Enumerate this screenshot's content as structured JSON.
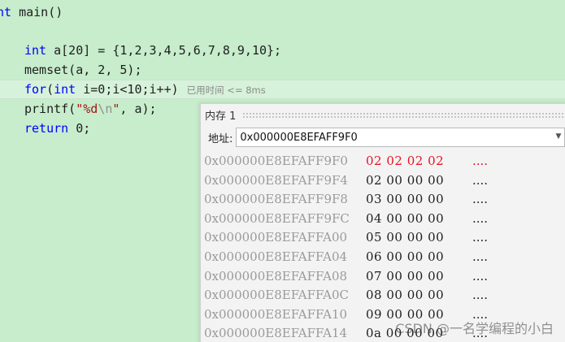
{
  "editor": {
    "line1": {
      "kw": "nt",
      "rest": " main()"
    },
    "line2": {
      "kw": "int",
      "rest": " a[20] = {1,2,3,4,5,6,7,8,9,10};"
    },
    "line3": {
      "rest": "memset(a, 2, 5);"
    },
    "line4": {
      "kw1": "for",
      "p1": "(",
      "kw2": "int",
      "rest": " i=0;i<10;i++)",
      "elapsed": "已用时间 <= 8ms"
    },
    "line5": {
      "fn": "printf(",
      "str1": "\"%d",
      "esc": "\\n",
      "str2": "\"",
      "rest": ", a);"
    },
    "line6": {
      "kw": "return",
      "rest": " 0;"
    }
  },
  "memory": {
    "title": "内存 1",
    "address_label": "地址:",
    "address_value": "0x000000E8EFAFF9F0",
    "rows": [
      {
        "addr": "0x000000E8EFAFF9F0",
        "bytes": "02 02 02 02",
        "ascii": "....",
        "changed": true
      },
      {
        "addr": "0x000000E8EFAFF9F4",
        "bytes": "02 00 00 00",
        "ascii": "....",
        "changed": false
      },
      {
        "addr": "0x000000E8EFAFF9F8",
        "bytes": "03 00 00 00",
        "ascii": "....",
        "changed": false
      },
      {
        "addr": "0x000000E8EFAFF9FC",
        "bytes": "04 00 00 00",
        "ascii": "....",
        "changed": false
      },
      {
        "addr": "0x000000E8EFAFFA00",
        "bytes": "05 00 00 00",
        "ascii": "....",
        "changed": false
      },
      {
        "addr": "0x000000E8EFAFFA04",
        "bytes": "06 00 00 00",
        "ascii": "....",
        "changed": false
      },
      {
        "addr": "0x000000E8EFAFFA08",
        "bytes": "07 00 00 00",
        "ascii": "....",
        "changed": false
      },
      {
        "addr": "0x000000E8EFAFFA0C",
        "bytes": "08 00 00 00",
        "ascii": "....",
        "changed": false
      },
      {
        "addr": "0x000000E8EFAFFA10",
        "bytes": "09 00 00 00",
        "ascii": "....",
        "changed": false
      },
      {
        "addr": "0x000000E8EFAFFA14",
        "bytes": "0a 00 00 00",
        "ascii": "....",
        "changed": false
      }
    ]
  },
  "watermark": "CSDN @一名学编程的小白",
  "colors": {
    "editor_bg": "#c7edcc",
    "keyword": "#0000ff",
    "string": "#a31515",
    "changed_bytes": "#e81123"
  }
}
